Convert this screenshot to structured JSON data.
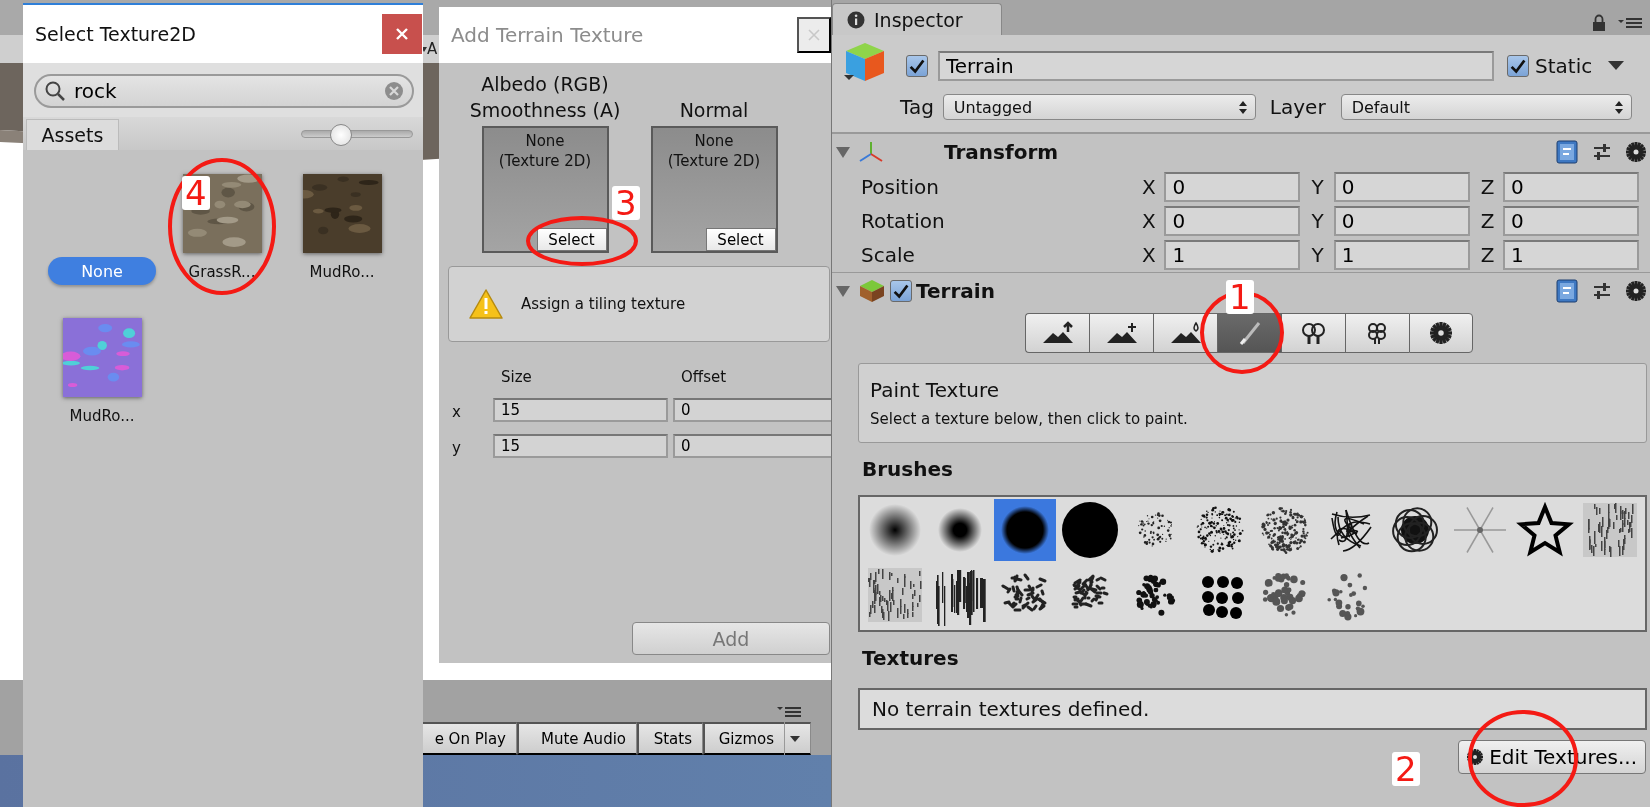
{
  "texture_picker": {
    "title": "Select Texture2D",
    "search": {
      "value": "rock"
    },
    "tab": "Assets",
    "zoom_slider": {
      "level": 0.36
    },
    "items": [
      {
        "kind": "none",
        "label": "None",
        "selected": true
      },
      {
        "kind": "gravel",
        "label": "GrassR...",
        "selected": false
      },
      {
        "kind": "mud",
        "label": "MudRo...",
        "selected": false
      },
      {
        "kind": "normalmap",
        "label": "MudRo...",
        "selected": false
      }
    ]
  },
  "scene_toolbar": {
    "text": "A"
  },
  "add_texture_dialog": {
    "title": "Add Terrain Texture",
    "slots": [
      {
        "label_lines": [
          "Albedo (RGB)",
          "Smoothness (A)"
        ],
        "value": "None",
        "type": "(Texture 2D)",
        "button": "Select"
      },
      {
        "label_lines": [
          "Normal"
        ],
        "value": "None",
        "type": "(Texture 2D)",
        "button": "Select"
      }
    ],
    "warning": "Assign a tiling texture",
    "tiling": {
      "columns": [
        "Size",
        "Offset"
      ],
      "rows": [
        {
          "axis": "x",
          "values": [
            "15",
            "0"
          ]
        },
        {
          "axis": "y",
          "values": [
            "15",
            "0"
          ]
        }
      ]
    },
    "add_button": {
      "label": "Add",
      "disabled": true
    }
  },
  "game_view": {
    "toolbar": [
      {
        "label": "e On Play",
        "dropdown": false
      },
      {
        "label": "Mute Audio",
        "dropdown": false
      },
      {
        "label": "Stats",
        "dropdown": false
      },
      {
        "label": "Gizmos",
        "dropdown": true
      }
    ]
  },
  "inspector": {
    "tab": "Inspector",
    "object": {
      "active": true,
      "name": "Terrain",
      "static": true,
      "static_label": "Static",
      "tag_label": "Tag",
      "tag": "Untagged",
      "layer_label": "Layer",
      "layer": "Default"
    },
    "components": [
      {
        "kind": "transform",
        "title": "Transform",
        "expanded": true,
        "rows": [
          {
            "label": "Position",
            "values": [
              {
                "axis": "X",
                "value": "0"
              },
              {
                "axis": "Y",
                "value": "0"
              },
              {
                "axis": "Z",
                "value": "0"
              }
            ]
          },
          {
            "label": "Rotation",
            "values": [
              {
                "axis": "X",
                "value": "0"
              },
              {
                "axis": "Y",
                "value": "0"
              },
              {
                "axis": "Z",
                "value": "0"
              }
            ]
          },
          {
            "label": "Scale",
            "values": [
              {
                "axis": "X",
                "value": "1"
              },
              {
                "axis": "Y",
                "value": "1"
              },
              {
                "axis": "Z",
                "value": "1"
              }
            ]
          }
        ]
      },
      {
        "kind": "terrain",
        "title": "Terrain",
        "expanded": true,
        "enabled": true,
        "tools": [
          {
            "kind": "raise",
            "selected": false
          },
          {
            "kind": "stamp",
            "selected": false
          },
          {
            "kind": "smooth",
            "selected": false
          },
          {
            "kind": "paint",
            "selected": true
          },
          {
            "kind": "trees",
            "selected": false
          },
          {
            "kind": "details",
            "selected": false
          },
          {
            "kind": "settings",
            "selected": false
          }
        ],
        "tool_title": "Paint Texture",
        "tool_hint": "Select a texture below, then click to paint.",
        "brushes_heading": "Brushes",
        "brushes": [
          {
            "kind": "soft",
            "selected": false
          },
          {
            "kind": "softsmall",
            "selected": false
          },
          {
            "kind": "hard",
            "selected": true
          },
          {
            "kind": "hardlarge",
            "selected": false
          },
          {
            "kind": "sparse",
            "selected": false
          },
          {
            "kind": "speckle",
            "selected": false
          },
          {
            "kind": "dense",
            "selected": false
          },
          {
            "kind": "scribble",
            "selected": false
          },
          {
            "kind": "rings",
            "selected": false
          },
          {
            "kind": "snowflake",
            "selected": false
          },
          {
            "kind": "star",
            "selected": false
          },
          {
            "kind": "noise",
            "selected": false
          },
          {
            "kind": "noise",
            "selected": false
          },
          {
            "kind": "streaks",
            "selected": false
          },
          {
            "kind": "smudge",
            "selected": false
          },
          {
            "kind": "smudge",
            "selected": false
          },
          {
            "kind": "blot",
            "selected": false
          },
          {
            "kind": "dots",
            "selected": false
          },
          {
            "kind": "spots",
            "selected": false
          },
          {
            "kind": "spotssparse",
            "selected": false
          }
        ],
        "textures_heading": "Textures",
        "textures_empty": "No terrain textures defined.",
        "edit_button": "Edit Textures..."
      }
    ]
  },
  "annotations": [
    {
      "label": "4"
    },
    {
      "label": "3"
    },
    {
      "label": "1"
    },
    {
      "label": "2"
    }
  ]
}
